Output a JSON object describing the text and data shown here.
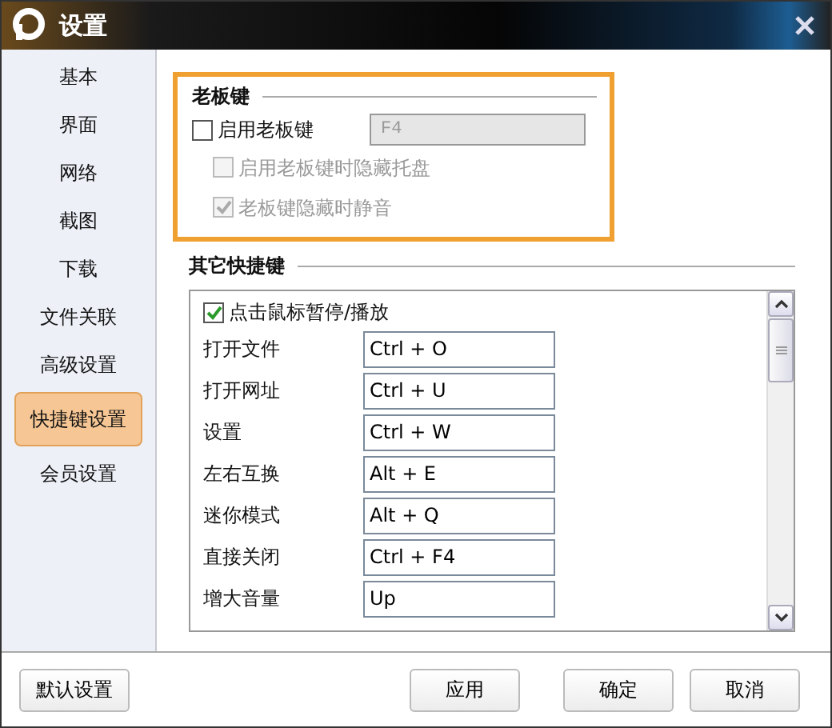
{
  "window": {
    "title": "设置"
  },
  "sidebar": {
    "items": [
      {
        "label": "基本",
        "selected": false
      },
      {
        "label": "界面",
        "selected": false
      },
      {
        "label": "网络",
        "selected": false
      },
      {
        "label": "截图",
        "selected": false
      },
      {
        "label": "下载",
        "selected": false
      },
      {
        "label": "文件关联",
        "selected": false
      },
      {
        "label": "高级设置",
        "selected": false
      },
      {
        "label": "快捷键设置",
        "selected": true
      },
      {
        "label": "会员设置",
        "selected": false
      }
    ]
  },
  "boss_key": {
    "heading": "老板键",
    "enable": {
      "label": "启用老板键",
      "checked": false
    },
    "key_field": {
      "value": "F4",
      "disabled": true
    },
    "options": [
      {
        "label": "启用老板键时隐藏托盘",
        "checked": false,
        "disabled": true
      },
      {
        "label": "老板键隐藏时静音",
        "checked": true,
        "disabled": true
      }
    ]
  },
  "other_shortcuts": {
    "heading": "其它快捷键",
    "pause_on_click": {
      "label": "点击鼠标暂停/播放",
      "checked": true
    },
    "rows": [
      {
        "label": "打开文件",
        "value": "Ctrl + O"
      },
      {
        "label": "打开网址",
        "value": "Ctrl + U"
      },
      {
        "label": "设置",
        "value": "Ctrl + W"
      },
      {
        "label": "左右互换",
        "value": "Alt + E"
      },
      {
        "label": "迷你模式",
        "value": "Alt + Q"
      },
      {
        "label": "直接关闭",
        "value": "Ctrl + F4"
      },
      {
        "label": "增大音量",
        "value": "Up"
      }
    ]
  },
  "buttons": {
    "left": [
      "默认设置"
    ],
    "right": [
      "应用",
      "确定",
      "取消"
    ]
  }
}
